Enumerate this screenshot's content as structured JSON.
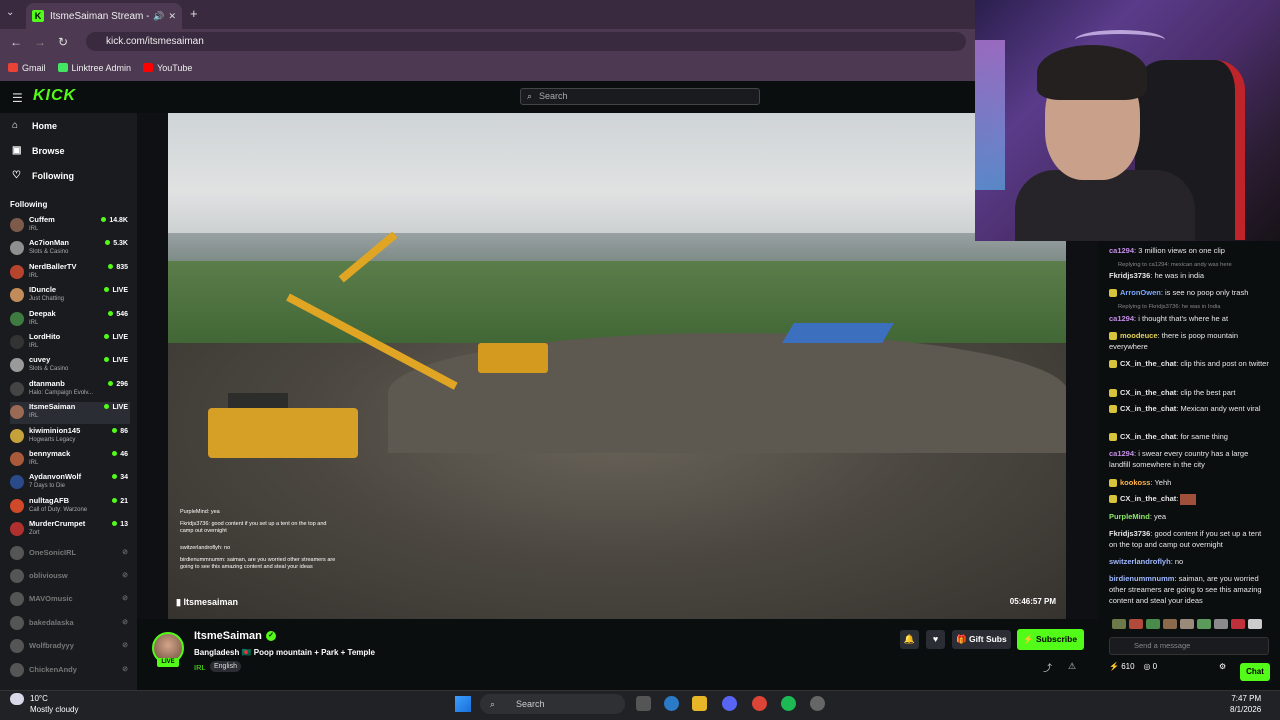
{
  "browser": {
    "tab_title": "ItsmeSaiman Stream - Watch",
    "url": "kick.com/itsmesaiman",
    "bookmarks": [
      {
        "label": "Gmail",
        "color": "#ea4335"
      },
      {
        "label": "Linktree Admin",
        "color": "#43e660"
      },
      {
        "label": "YouTube",
        "color": "#ff0000"
      }
    ]
  },
  "kick": {
    "logo": "KICK",
    "search_placeholder": "Search",
    "nav": [
      {
        "label": "Home",
        "icon": "home-icon",
        "glyph": "⌂"
      },
      {
        "label": "Browse",
        "icon": "browse-icon",
        "glyph": "▣"
      },
      {
        "label": "Following",
        "icon": "heart-icon",
        "glyph": "♡"
      }
    ],
    "following_header": "Following",
    "following": [
      {
        "name": "Cuffem",
        "category": "IRL",
        "viewers": "14.8K",
        "online": true,
        "color": "#7d5a4a"
      },
      {
        "name": "Ac7ionMan",
        "category": "Slots & Casino",
        "viewers": "5.3K",
        "online": true,
        "color": "#8f8f8f"
      },
      {
        "name": "NerdBallerTV",
        "category": "IRL",
        "viewers": "835",
        "online": true,
        "color": "#b7452e"
      },
      {
        "name": "IDuncle",
        "category": "Just Chatting",
        "viewers": "LIVE",
        "online": true,
        "color": "#c28c5a"
      },
      {
        "name": "Deepak",
        "category": "IRL",
        "viewers": "546",
        "online": true,
        "color": "#3d7b40"
      },
      {
        "name": "LordHito",
        "category": "IRL",
        "viewers": "LIVE",
        "online": true,
        "color": "#333333"
      },
      {
        "name": "cuvey",
        "category": "Slots & Casino",
        "viewers": "LIVE",
        "online": true,
        "color": "#9a9a9a"
      },
      {
        "name": "dtanmanb",
        "category": "Halo: Campaign Evolv...",
        "viewers": "296",
        "online": true,
        "color": "#444444"
      },
      {
        "name": "ItsmeSaiman",
        "category": "IRL",
        "viewers": "LIVE",
        "online": true,
        "color": "#9a6a55",
        "active": true
      },
      {
        "name": "kiwiminion145",
        "category": "Hogwarts Legacy",
        "viewers": "86",
        "online": true,
        "color": "#c4a13a"
      },
      {
        "name": "bennymack",
        "category": "IRL",
        "viewers": "46",
        "online": true,
        "color": "#a85a3a"
      },
      {
        "name": "AydanvonWolf",
        "category": "7 Days to Die",
        "viewers": "34",
        "online": true,
        "color": "#2a4a8a"
      },
      {
        "name": "nulltagAFB",
        "category": "Call of Duty: Warzone",
        "viewers": "21",
        "online": true,
        "color": "#d04a2a"
      },
      {
        "name": "MurderCrumpet",
        "category": "Zort",
        "viewers": "13",
        "online": true,
        "color": "#b03030"
      },
      {
        "name": "OneSonicIRL",
        "category": "",
        "viewers": "",
        "online": false,
        "color": "#555555"
      },
      {
        "name": "obliviousw",
        "category": "",
        "viewers": "",
        "online": false,
        "color": "#555555"
      },
      {
        "name": "MAVOmusic",
        "category": "",
        "viewers": "",
        "online": false,
        "color": "#555555"
      },
      {
        "name": "bakedalaska",
        "category": "",
        "viewers": "",
        "online": false,
        "color": "#555555"
      },
      {
        "name": "Wolfbradyyy",
        "category": "",
        "viewers": "",
        "online": false,
        "color": "#555555"
      },
      {
        "name": "ChickenAndy",
        "category": "",
        "viewers": "",
        "online": false,
        "color": "#555555"
      }
    ]
  },
  "video": {
    "overlay_chat": [
      {
        "text": "PurpleMind: yea"
      },
      {
        "text": "Fkridjs3736: good content if you set up a tent on the top and camp out overnight"
      },
      {
        "text": "switzerlandroflyh: no"
      },
      {
        "text": "birdienummnumm: saiman, are you worried other streamers are going to see this amazing content and steal your ideas"
      }
    ],
    "overlay_name": "Itsmesaiman",
    "overlay_time": "05:46:57 PM"
  },
  "stream": {
    "channel_name": "ItsmeSaiman",
    "live_label": "LIVE",
    "title": "Bangladesh 🇧🇩 Poop mountain + Park + Temple",
    "category": "IRL",
    "language": "English",
    "gift_label": "Gift Subs",
    "subscribe_label": "Subscribe"
  },
  "chat": {
    "messages": [
      {
        "user": "ca1294",
        "text": "3 million views on one clip",
        "color": "#c48ee6",
        "badge": false
      },
      {
        "reply": "Replying to ca1294: mexican andy was here"
      },
      {
        "user": "Fkridjs3736",
        "text": "he was in india",
        "color": "#e7e7e7",
        "badge": false
      },
      {
        "user": "ArronOwen",
        "text": "is see no poop only trash",
        "color": "#7aa8ff",
        "badge": true
      },
      {
        "reply": "Replying to Fkridjs3736: he was in India"
      },
      {
        "user": "ca1294",
        "text": "i thought that's where he at",
        "color": "#c48ee6",
        "badge": false
      },
      {
        "user": "moodeuce",
        "text": "there is poop mountain everywhere",
        "color": "#e6d35a",
        "badge": true
      },
      {
        "user": "CX_in_the_chat",
        "text": "clip this and post on twitter",
        "color": "#e7e7e7",
        "badge": true
      },
      {
        "user": "CX_in_the_chat",
        "text": "clip the best part",
        "color": "#e7e7e7",
        "badge": true
      },
      {
        "user": "CX_in_the_chat",
        "text": "Mexican andy went viral",
        "color": "#e7e7e7",
        "badge": true
      },
      {
        "user": "CX_in_the_chat",
        "text": "for same thing",
        "color": "#e7e7e7",
        "badge": true
      },
      {
        "user": "ca1294",
        "text": "i swear every country has a large landfill somewhere in the city",
        "color": "#c48ee6",
        "badge": false
      },
      {
        "user": "kookoss",
        "text": "Yehh",
        "color": "#ffb347",
        "badge": true
      },
      {
        "user": "CX_in_the_chat",
        "text": "",
        "color": "#e7e7e7",
        "badge": true
      },
      {
        "user": "PurpleMind",
        "text": "yea",
        "color": "#8de86a",
        "badge": false
      },
      {
        "user": "Fkridjs3736",
        "text": "good content if you set up a tent on the top and camp out overnight",
        "color": "#e7e7e7",
        "badge": false
      },
      {
        "user": "switzerlandroflyh",
        "text": "no",
        "color": "#9fb8ff",
        "badge": false
      },
      {
        "user": "birdienummnumm",
        "text": "saiman, are you worried other streamers are going to see this amazing content and steal your ideas",
        "color": "#9fb8ff",
        "badge": false
      }
    ],
    "send_placeholder": "Send a message",
    "points": "610",
    "points2": "0",
    "chat_button": "Chat"
  },
  "taskbar": {
    "temp": "10°C",
    "weather": "Mostly cloudy",
    "search": "Search",
    "time": "7:47 PM",
    "date": "8/1/2026"
  }
}
